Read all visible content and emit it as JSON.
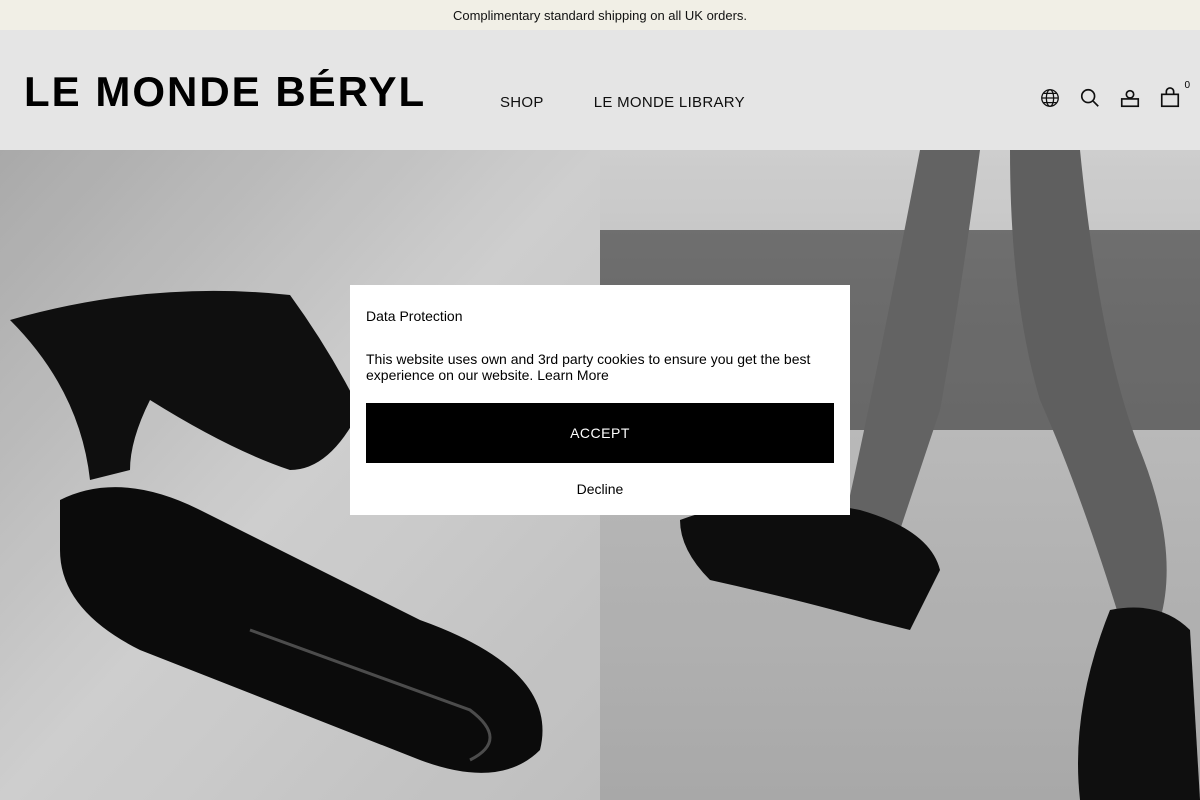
{
  "announcement": "Complimentary standard shipping on all UK orders.",
  "brand": {
    "logo": "LE MONDE BÉRYL"
  },
  "nav": {
    "shop": "SHOP",
    "library": "LE MONDE LIBRARY"
  },
  "header_icons": {
    "language": "globe-icon",
    "search": "search-icon",
    "account": "user-icon",
    "cart": "bag-icon",
    "cart_count": "0"
  },
  "hero": {
    "left_image": "black leather mules on light surface",
    "right_image": "model legs wearing black mules"
  },
  "cookie_modal": {
    "title": "Data Protection",
    "text": "This website uses own and 3rd party cookies to ensure you get the best experience on our website.",
    "learn_more": "Learn More",
    "accept": "ACCEPT",
    "decline": "Decline"
  },
  "colors": {
    "announce_bg": "#f1efe6",
    "accent": "#000000"
  }
}
